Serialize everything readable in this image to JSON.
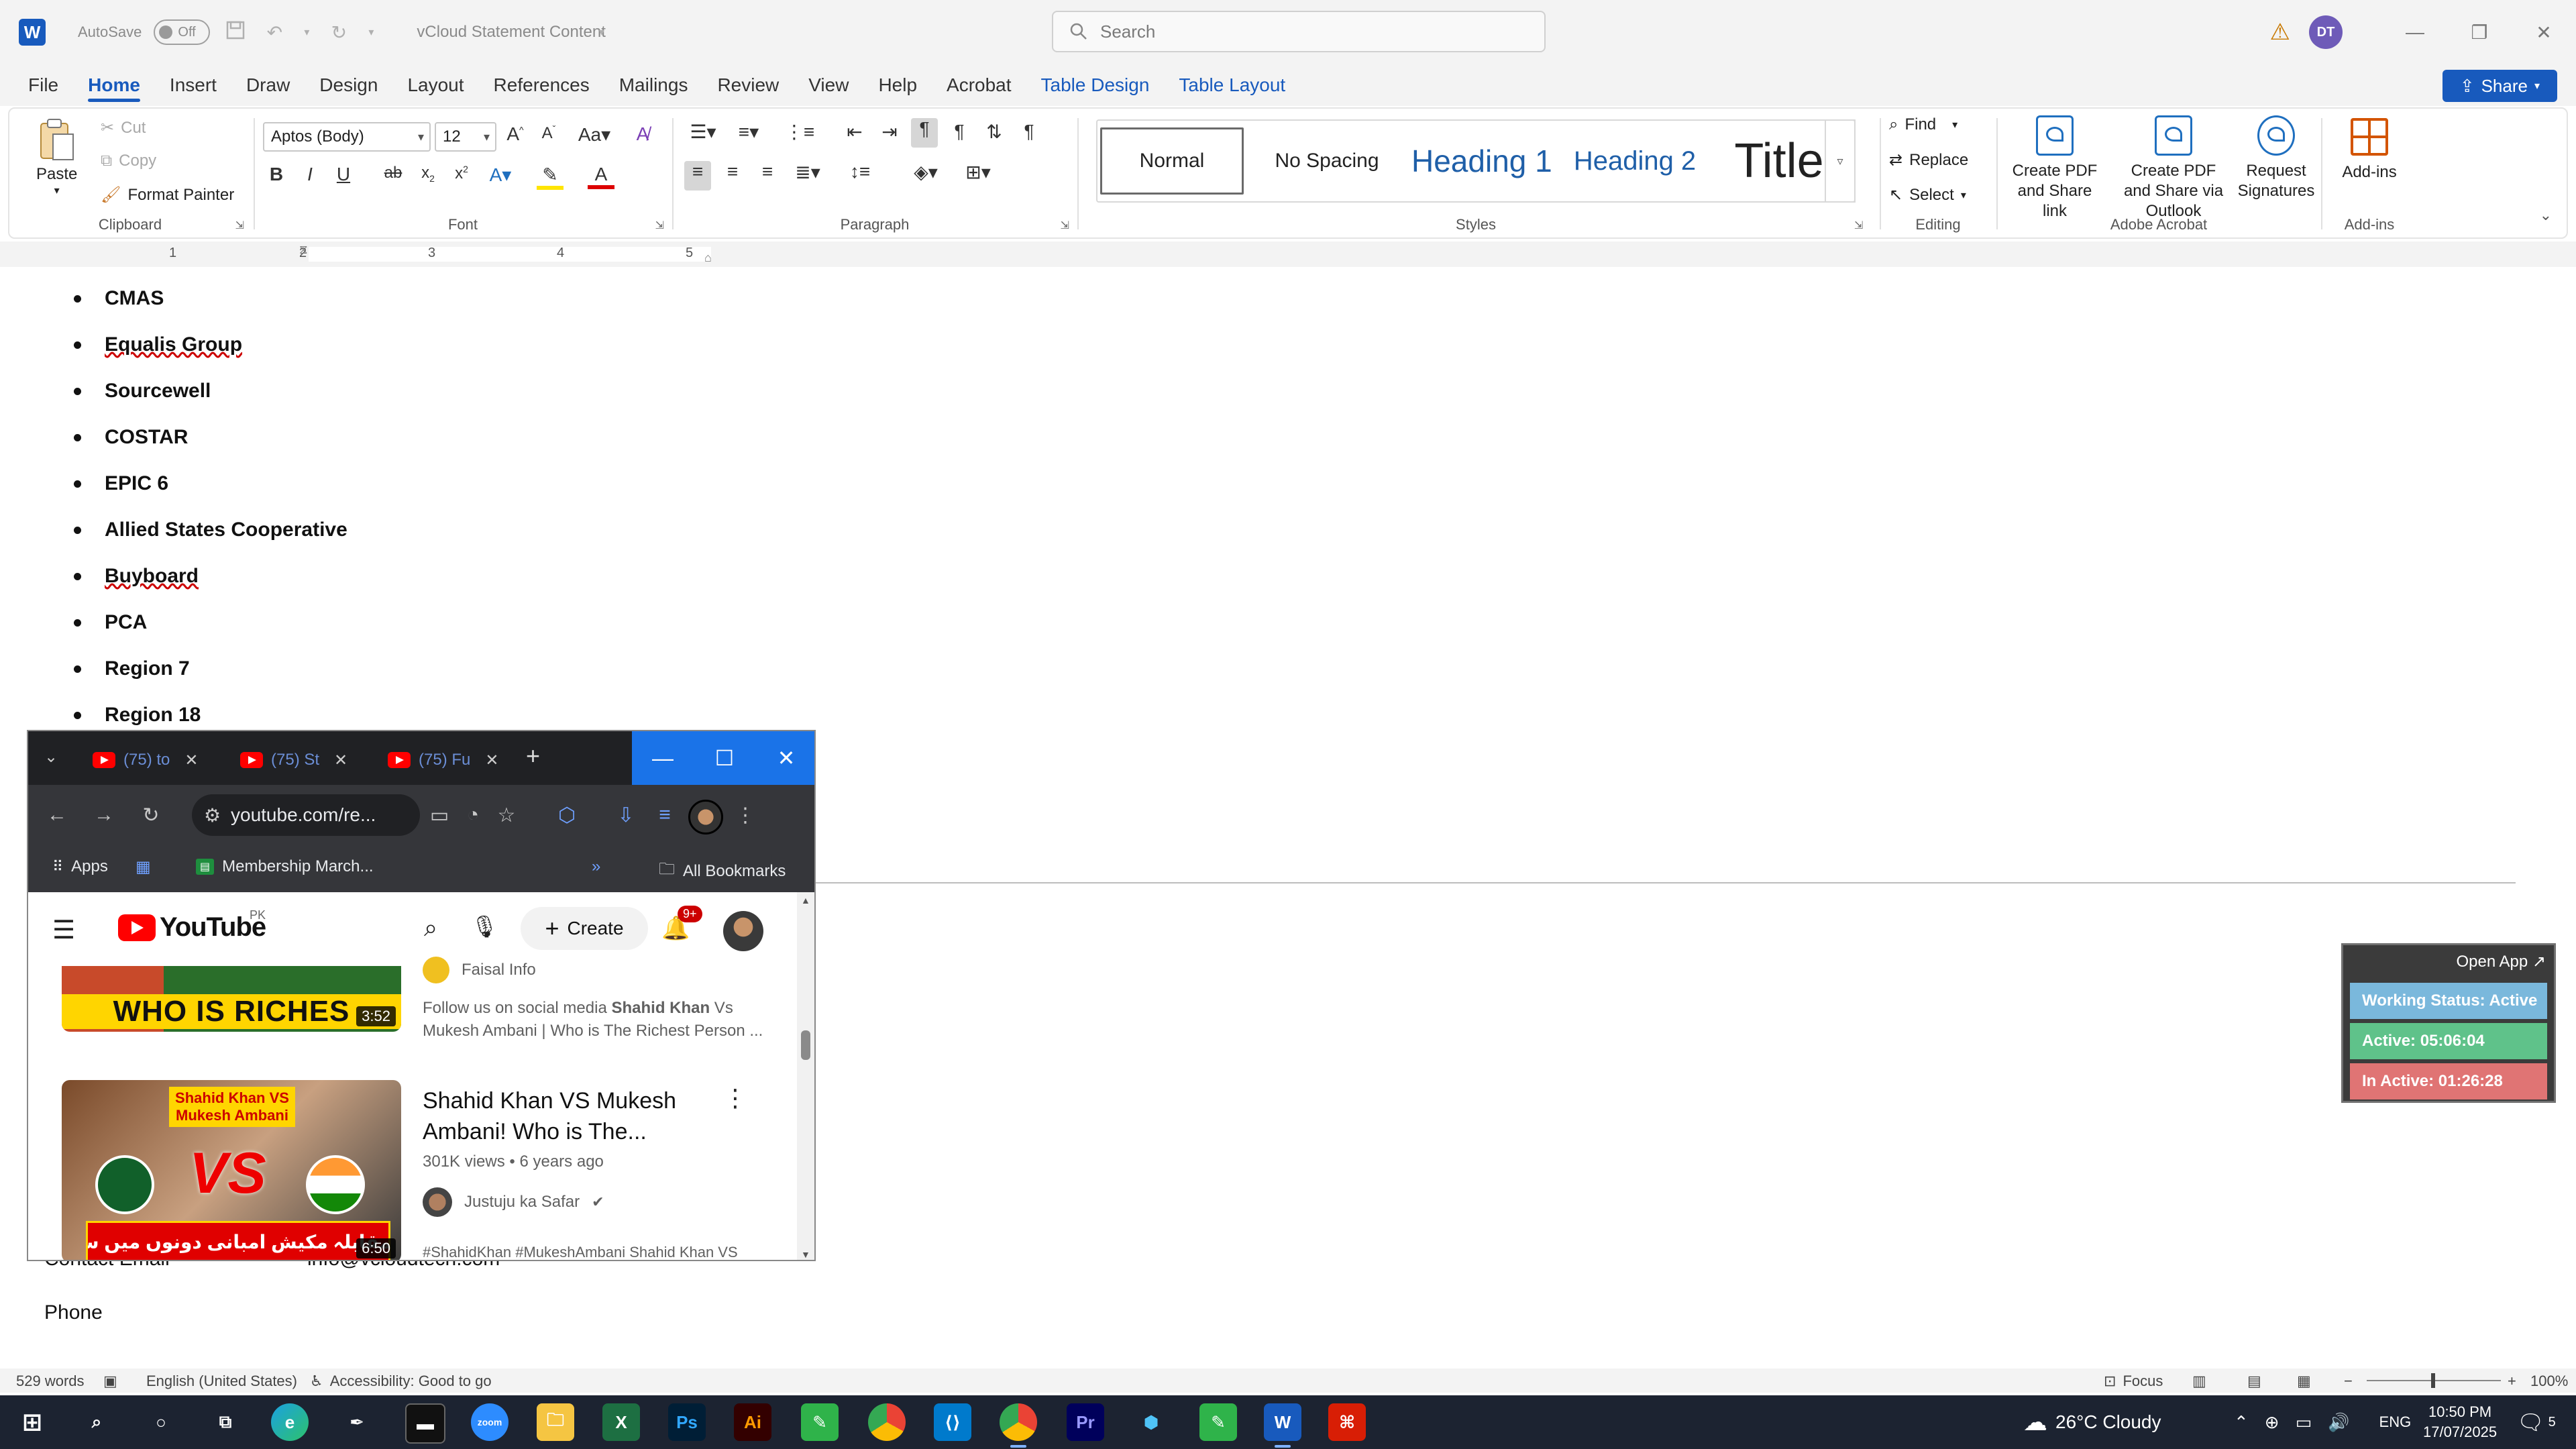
{
  "titlebar": {
    "app_icon": "W",
    "autosave_label": "AutoSave",
    "autosave_state": "Off",
    "doc_title": "vCloud Statement Content",
    "search_placeholder": "Search",
    "user_initials": "DT"
  },
  "menu": {
    "tabs": [
      "File",
      "Home",
      "Insert",
      "Draw",
      "Design",
      "Layout",
      "References",
      "Mailings",
      "Review",
      "View",
      "Help",
      "Acrobat",
      "Table Design",
      "Table Layout"
    ],
    "active": "Home",
    "share_label": "Share"
  },
  "ribbon": {
    "clipboard": {
      "paste": "Paste",
      "cut": "Cut",
      "copy": "Copy",
      "format_painter": "Format Painter",
      "label": "Clipboard"
    },
    "font": {
      "family": "Aptos (Body)",
      "size": "12",
      "label": "Font"
    },
    "paragraph": {
      "label": "Paragraph"
    },
    "styles": {
      "items": [
        "Normal",
        "No Spacing",
        "Heading 1",
        "Heading 2",
        "Title"
      ],
      "label": "Styles"
    },
    "editing": {
      "find": "Find",
      "replace": "Replace",
      "select": "Select",
      "label": "Editing"
    },
    "acrobat": {
      "create_pdf_share": "Create PDF and Share link",
      "create_pdf_outlook": "Create PDF and Share via Outlook",
      "request_signatures": "Request Signatures",
      "label": "Adobe Acrobat"
    },
    "addins": {
      "button": "Add-ins",
      "label": "Add-ins"
    }
  },
  "ruler": {
    "numbers": [
      "1",
      "2",
      "3",
      "4",
      "5"
    ]
  },
  "document": {
    "bullets": [
      "CMAS",
      "Equalis Group",
      "Sourcewell",
      "COSTAR",
      "EPIC 6",
      "Allied States Cooperative",
      "Buyboard",
      "PCA",
      "Region 7",
      "Region 18"
    ],
    "contact_email_label": "Contact Email",
    "contact_email_value": "info@vcloudtech.com",
    "phone_label": "Phone"
  },
  "statusbar": {
    "words": "529 words",
    "language": "English (United States)",
    "accessibility": "Accessibility: Good to go",
    "focus": "Focus",
    "zoom": "100%"
  },
  "chrome": {
    "tabs": [
      {
        "label": "(75) to"
      },
      {
        "label": "(75) St"
      },
      {
        "label": "(75) Fu"
      }
    ],
    "url": "youtube.com/re...",
    "bookmarks": {
      "apps": "Apps",
      "membership": "Membership March...",
      "all": "All Bookmarks"
    },
    "youtube": {
      "logo_text": "YouTube",
      "country": "PK",
      "create": "Create",
      "notifications": "9+",
      "video1": {
        "thumb_text": "WHO IS RICHES",
        "duration": "3:52",
        "channel": "Faisal Info",
        "desc_prefix": "Follow us on social media ",
        "desc_bold": "Shahid Khan",
        "desc_rest": " Vs Mukesh Ambani | Who is The Richest Person ..."
      },
      "video2": {
        "title": "Shahid Khan VS Mukesh Ambani! Who is The...",
        "meta": "301K views • 6 years ago",
        "channel": "Justuju ka Safar",
        "thumb_label": "Shahid Khan VS Mukesh Ambani",
        "thumb_vs": "VS",
        "thumb_urdu": "شاہد خان بمقابلہ مکیش امبانی دونوں میں سے امیر کون",
        "duration": "6:50",
        "desc": "#ShahidKhan #MukeshAmbani Shahid Khan VS"
      }
    }
  },
  "tracker": {
    "open_app": "Open App ↗",
    "working_status": "Working Status: Active",
    "active": "Active: 05:06:04",
    "inactive": "In Active: 01:26:28",
    "colors": {
      "status": "#7ab8dc",
      "active": "#5fc28a",
      "inactive": "#e07474"
    }
  },
  "taskbar": {
    "weather": "26°C Cloudy",
    "lang": "ENG",
    "time": "10:50 PM",
    "date": "17/07/2025",
    "notif_count": "5",
    "apps": [
      "start",
      "search",
      "cortana",
      "task-view",
      "edge",
      "pen",
      "terminal",
      "zoom",
      "file-explorer",
      "excel",
      "photoshop",
      "illustrator",
      "green-app",
      "chrome",
      "vscode",
      "chrome-active",
      "premiere",
      "network-app",
      "green-app-2",
      "word",
      "acrobat"
    ]
  }
}
